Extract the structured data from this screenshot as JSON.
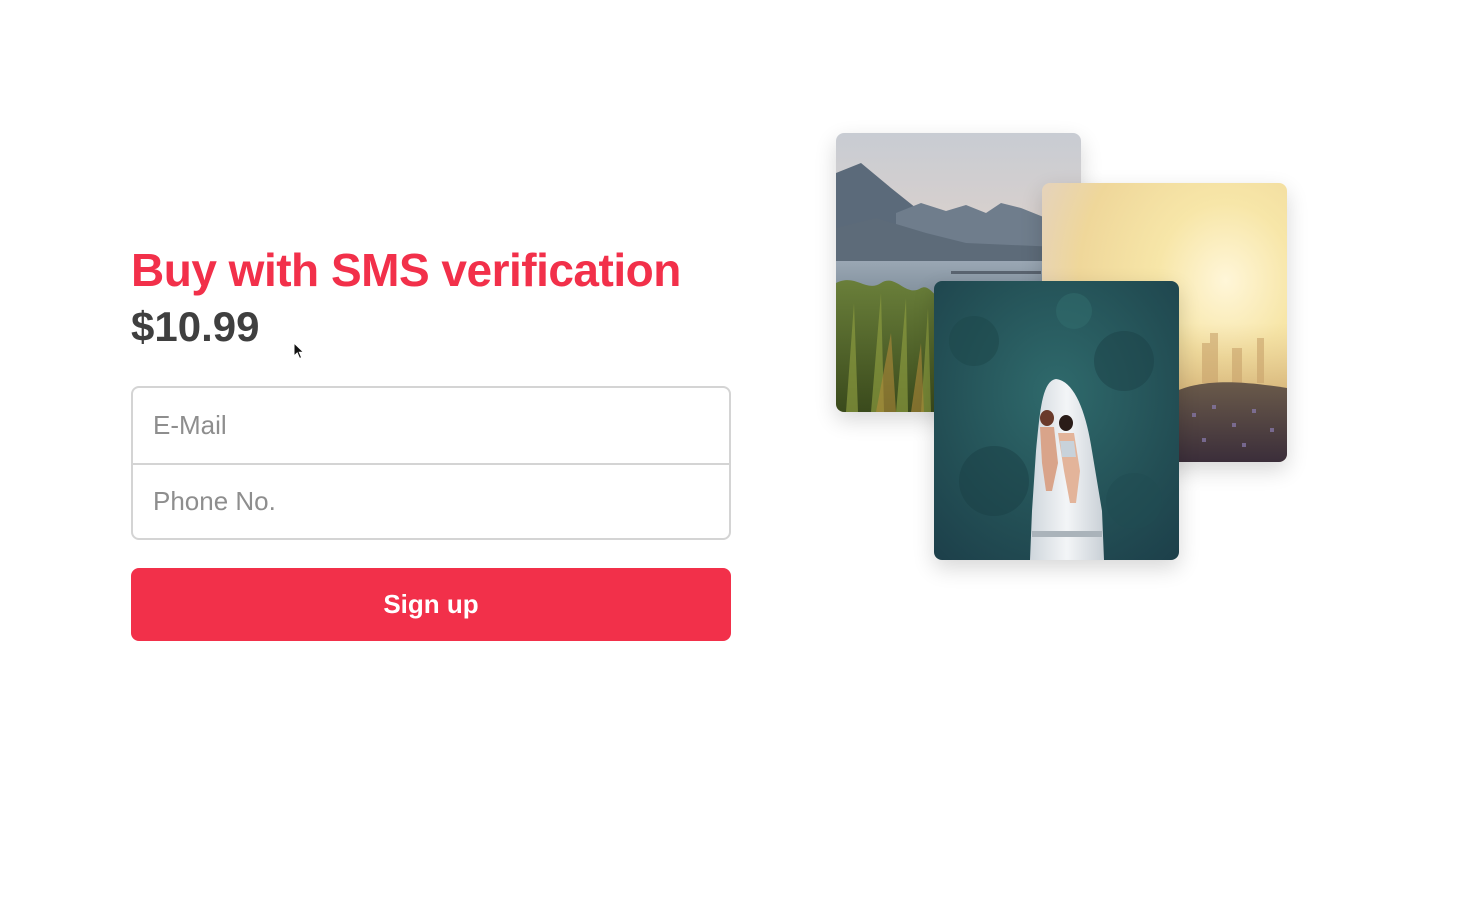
{
  "product": {
    "title": "Buy with SMS verification",
    "price": "$10.99"
  },
  "form": {
    "email_placeholder": "E-Mail",
    "phone_placeholder": "Phone No.",
    "submit_label": "Sign up"
  },
  "gallery": {
    "photos": [
      "mountain-lake-photo",
      "sunset-meadow-photo",
      "couple-on-boat-photo"
    ]
  },
  "colors": {
    "accent": "#f2304a",
    "price_text": "#3f3f3f",
    "border": "#d4d4d4"
  }
}
